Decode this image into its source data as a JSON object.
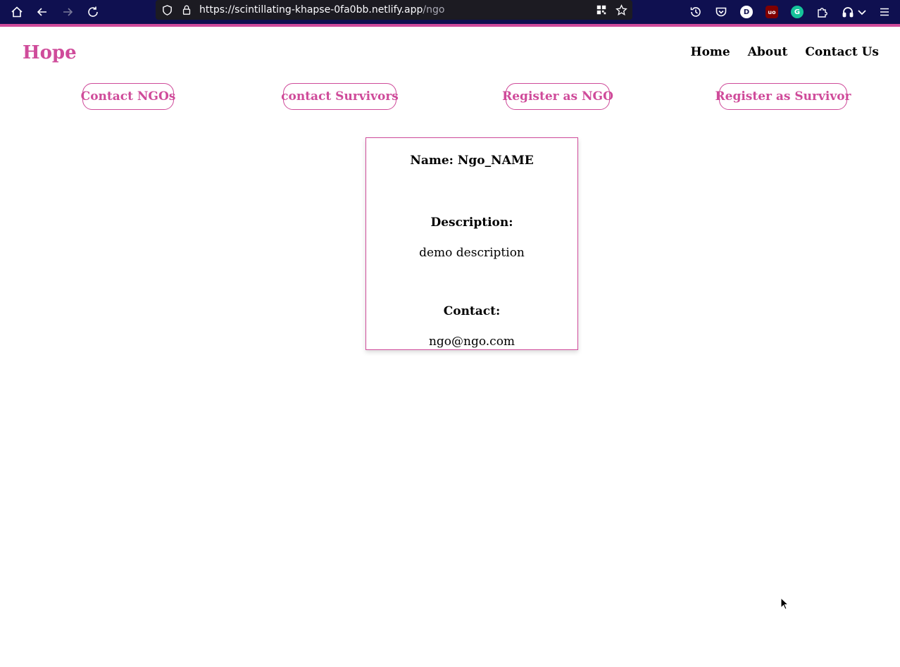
{
  "browser": {
    "url_host": "https://scintillating-khapse-0fa0bb.netlify.app",
    "url_path": "/ngo",
    "icons": [
      "home-icon",
      "back-icon",
      "forward-icon",
      "reload-icon",
      "shield-icon",
      "lock-icon",
      "qr-icon",
      "bookmark-star-icon",
      "history-icon",
      "pocket-icon",
      "extension-d-icon",
      "ublock-icon",
      "grammarly-icon",
      "puzzle-icon",
      "headphones-icon",
      "chevron-down-icon",
      "menu-icon"
    ],
    "extension_d_label": "D",
    "extension_ublock_label": "uo",
    "extension_grammarly_label": "G",
    "colors": {
      "toolbar": "#0f1050",
      "accent": "#cf4b9a"
    }
  },
  "site": {
    "logo": "Hope",
    "nav": [
      "Home",
      "About",
      "Contact Us"
    ],
    "actions": [
      "Contact NGOs",
      "contact Survivors",
      "Register as NGO",
      "Register as Survivor"
    ],
    "brand_color": "#cf4b9a"
  },
  "card": {
    "name_label": "Name: Ngo_NAME",
    "description_label": "Description:",
    "description": "demo description",
    "contact_label": "Contact:",
    "contact": "ngo@ngo.com"
  }
}
